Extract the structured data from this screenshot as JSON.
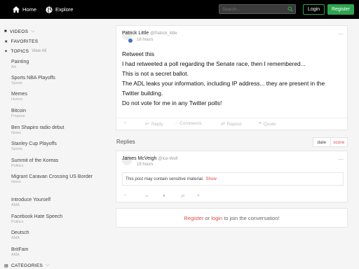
{
  "topbar": {
    "home_label": "Home",
    "explore_label": "Explore",
    "search_placeholder": "Search...",
    "login_label": "Login",
    "register_label": "Register"
  },
  "sidebar": {
    "videos_label": "VIDEOS",
    "favorites_label": "FAVORITES",
    "topics_label": "TOPICS",
    "view_all_label": "View All",
    "categories_label": "CATEGORIES",
    "topics": [
      {
        "name": "Painting",
        "category": "Art"
      },
      {
        "name": "Sports NBA Playoffs",
        "category": "Sports"
      },
      {
        "name": "Memes",
        "category": "Humor"
      },
      {
        "name": "Bitcoin",
        "category": "Finance"
      },
      {
        "name": "Ben Shapiro radio debut",
        "category": "News"
      },
      {
        "name": "Stanley Cup Playoffs",
        "category": "Sports"
      },
      {
        "name": "Summit of the Koreas",
        "category": "Politics"
      },
      {
        "name": "Migrant Caravan Crossing US Border",
        "category": "News"
      },
      {
        "name": "Introduce Yourself",
        "category": "AMA"
      },
      {
        "name": "Facebook Hate Speech",
        "category": "Politics"
      },
      {
        "name": "Deutsch",
        "category": "AMA"
      },
      {
        "name": "BritFam",
        "category": "AMA"
      }
    ]
  },
  "post": {
    "author": "Patrick Little",
    "handle": "@Patrick_little",
    "time": "18 hours",
    "lines": [
      "Retweet this",
      "I had retweeted a poll regarding the Senate race, then I remembered...",
      "This is not a secret ballot.",
      "The ADL leaks your information, including IP address... they are present in the",
      "Twitter building.",
      "Do not vote for me in any Twitter polls!"
    ],
    "actions": {
      "reply": "Reply",
      "comments": "Comments",
      "repost": "Repost",
      "quote": "Quote"
    }
  },
  "replies": {
    "label": "Replies",
    "sort_date": "date",
    "sort_score": "score",
    "items": [
      {
        "author": "James McVeigh",
        "handle": "@Ice-Wolf",
        "time": "18 hours",
        "sensitive_text": "This post may contain sensitive material.",
        "show_label": "Show"
      }
    ]
  },
  "join": {
    "register": "Register",
    "or": " or ",
    "login": "login",
    "rest": " to join the conversation!"
  },
  "colors": {
    "accent_green": "#2ea44f",
    "accent_red": "#e04848",
    "verified_blue": "#3b74c5"
  }
}
